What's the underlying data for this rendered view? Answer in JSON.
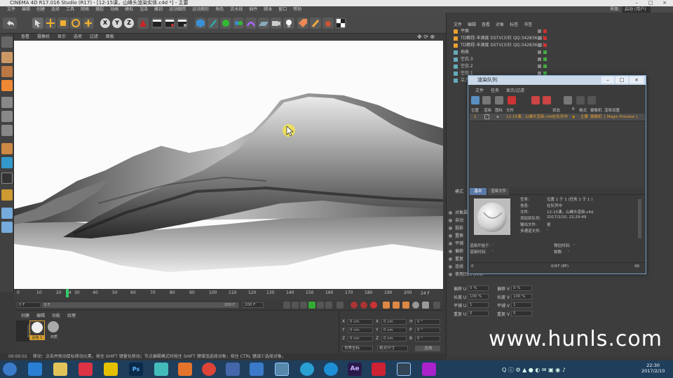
{
  "window": {
    "title": "CINEMA 4D R17.016 Studio (R17) - [12-15课，山峰头渲染实体.c4d *] - 主要",
    "buttons": [
      "–",
      "□",
      "×"
    ]
  },
  "menubar": {
    "items": [
      "文件",
      "编辑",
      "创建",
      "选择",
      "工具",
      "网格",
      "捕捉",
      "动画",
      "模拟",
      "渲染",
      "雕刻",
      "运动跟踪",
      "运动图形",
      "角色",
      "流水线",
      "插件",
      "脚本",
      "窗口",
      "帮助"
    ],
    "layout_label": "界面:",
    "layout_value": "启动 (用户)"
  },
  "toolbar": {
    "axis_x": "X",
    "axis_y": "Y",
    "axis_z": "Z"
  },
  "viewport": {
    "menu": [
      "查看",
      "摄像机",
      "显示",
      "选项",
      "过滤",
      "面板"
    ]
  },
  "timeline": {
    "ticks": [
      "0",
      "10",
      "20",
      "24",
      "30",
      "40",
      "50",
      "60",
      "70",
      "80",
      "90",
      "100",
      "110",
      "120",
      "130",
      "140",
      "150",
      "160",
      "170",
      "180",
      "190",
      "200"
    ],
    "current_frame_label": "24 F",
    "start": "0 F",
    "field_a": "0 F",
    "end_a": "200 F",
    "end_b": "200 F"
  },
  "material_manager": {
    "menu": [
      "创建",
      "编辑",
      "功能",
      "纹理"
    ],
    "materials": [
      "白色 1",
      "材质"
    ]
  },
  "coordinates": {
    "rows": [
      {
        "a": "X",
        "av": "0 cm",
        "b": "X",
        "bv": "0 cm",
        "c": "H",
        "cv": "0 °"
      },
      {
        "a": "Y",
        "av": "0 cm",
        "b": "Y",
        "bv": "0 cm",
        "c": "P",
        "cv": "0 °"
      },
      {
        "a": "Z",
        "av": "0 cm",
        "b": "Z",
        "bv": "0 cm",
        "c": "B",
        "cv": "0 °"
      }
    ],
    "mode1": "世界坐标",
    "mode2": "绝对尺寸",
    "apply": "应用"
  },
  "object_manager": {
    "menu": [
      "文件",
      "编辑",
      "查看",
      "对象",
      "标签",
      "书签"
    ],
    "objects": [
      "平面",
      "TD教程-丰满度 DSTV(3)社 QQ:342836011",
      "TD教程-丰满度 DSTV(3)社 QQ:342836011",
      "地表",
      "空白.3",
      "空白.2",
      "空白.1",
      "立方体"
    ]
  },
  "attributes": {
    "title": "模式",
    "tabs": [
      "基本",
      "坐标",
      "对象",
      "平滑着色"
    ],
    "labels": [
      "对象属性",
      "自动",
      "投影",
      "置换",
      "平铺",
      "偏移",
      "重复",
      "连续",
      "使用凹凸 UVW"
    ],
    "fields": [
      {
        "l": "偏移 U",
        "v": "0 %"
      },
      {
        "l": "偏移 V",
        "v": "0 %"
      },
      {
        "l": "长度 U",
        "v": "100 %"
      },
      {
        "l": "长度 V",
        "v": "100 %"
      },
      {
        "l": "平铺 U",
        "v": "1"
      },
      {
        "l": "平铺 V",
        "v": "1"
      },
      {
        "l": "重复 U",
        "v": "0"
      },
      {
        "l": "重复 V",
        "v": "0"
      }
    ]
  },
  "render_queue": {
    "title": "渲染队列",
    "menu": [
      "文件",
      "任务",
      "显示/过滤"
    ],
    "columns": [
      "位置",
      "渲染",
      "图标",
      "文件",
      "状态",
      "R",
      "格式",
      "摄像机",
      "渲染设置"
    ],
    "job": {
      "pos": "1",
      "file": "12-15课，山峰头渲染.c4d",
      "status": "在队列中",
      "take": "主要",
      "camera": "摄像机",
      "settings": "[ Magic Preview ]"
    },
    "tabs": [
      "基本",
      "渲染文件"
    ],
    "info": [
      {
        "k": "任务:",
        "v": "位置 1 于 1 (任务 1 于 1 )"
      },
      {
        "k": "信息:",
        "v": "在队列中"
      },
      {
        "k": "文件:",
        "v": "12-15课，山峰头渲染.c4d"
      },
      {
        "k": "添加到队列:",
        "v": "2017/2/10, 22:29:49"
      },
      {
        "k": "输出文件:",
        "v": "是"
      },
      {
        "k": "多通道文件:",
        "v": "-"
      }
    ],
    "render_start": "渲染开始于:",
    "render_start_val": "-",
    "render_time": "渲染时间:",
    "render_time_val": "-",
    "estimate": "预估时间:",
    "estimate_val": "-",
    "frame": "帧数:",
    "frame_val": "-",
    "footer_left": "0",
    "footer_mid": "0/97 (8F)",
    "footer_right": "96"
  },
  "status": {
    "time": "00:00:01",
    "text": "移动：点击并拖动鼠标移动元素。按住 SHIFT 键量化移动；节点编辑模式时按住 SHIFT 键增加选择对象；按住 CTRL 键减少选择对象。"
  },
  "taskbar": {
    "clock_time": "22:30",
    "clock_date": "2017/2/10",
    "ae_label": "Ae",
    "ps_label": "Ps"
  },
  "watermark": "www.hunls.com"
}
